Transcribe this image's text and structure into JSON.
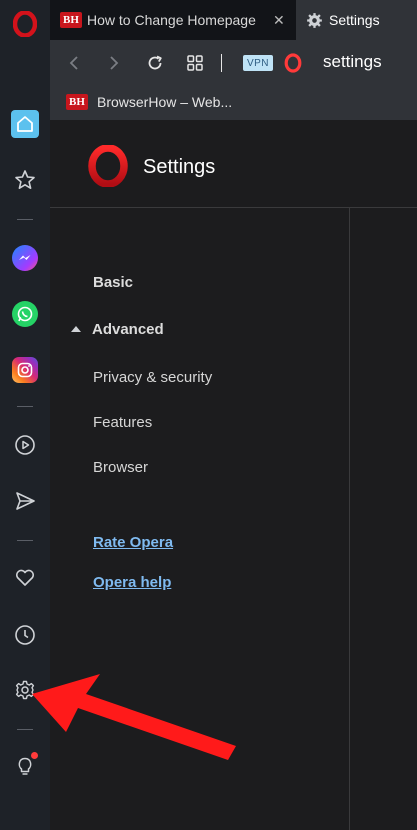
{
  "tabs": [
    {
      "favicon": "BH",
      "label": "How to Change Homepage",
      "close": "✕"
    },
    {
      "label": "Settings"
    }
  ],
  "toolbar": {
    "vpn_label": "VPN",
    "address": "settings"
  },
  "bookmarks": [
    {
      "favicon": "BH",
      "label": "BrowserHow – Web..."
    }
  ],
  "page": {
    "title": "Settings",
    "nav": {
      "basic": "Basic",
      "advanced": "Advanced",
      "privacy": "Privacy & security",
      "features": "Features",
      "browser": "Browser"
    },
    "links": {
      "rate": "Rate Opera",
      "help": "Opera help"
    }
  },
  "colors": {
    "accent": "#5cc1ee",
    "opera_red": "#d3121b",
    "arrow": "#ff1a1a"
  }
}
